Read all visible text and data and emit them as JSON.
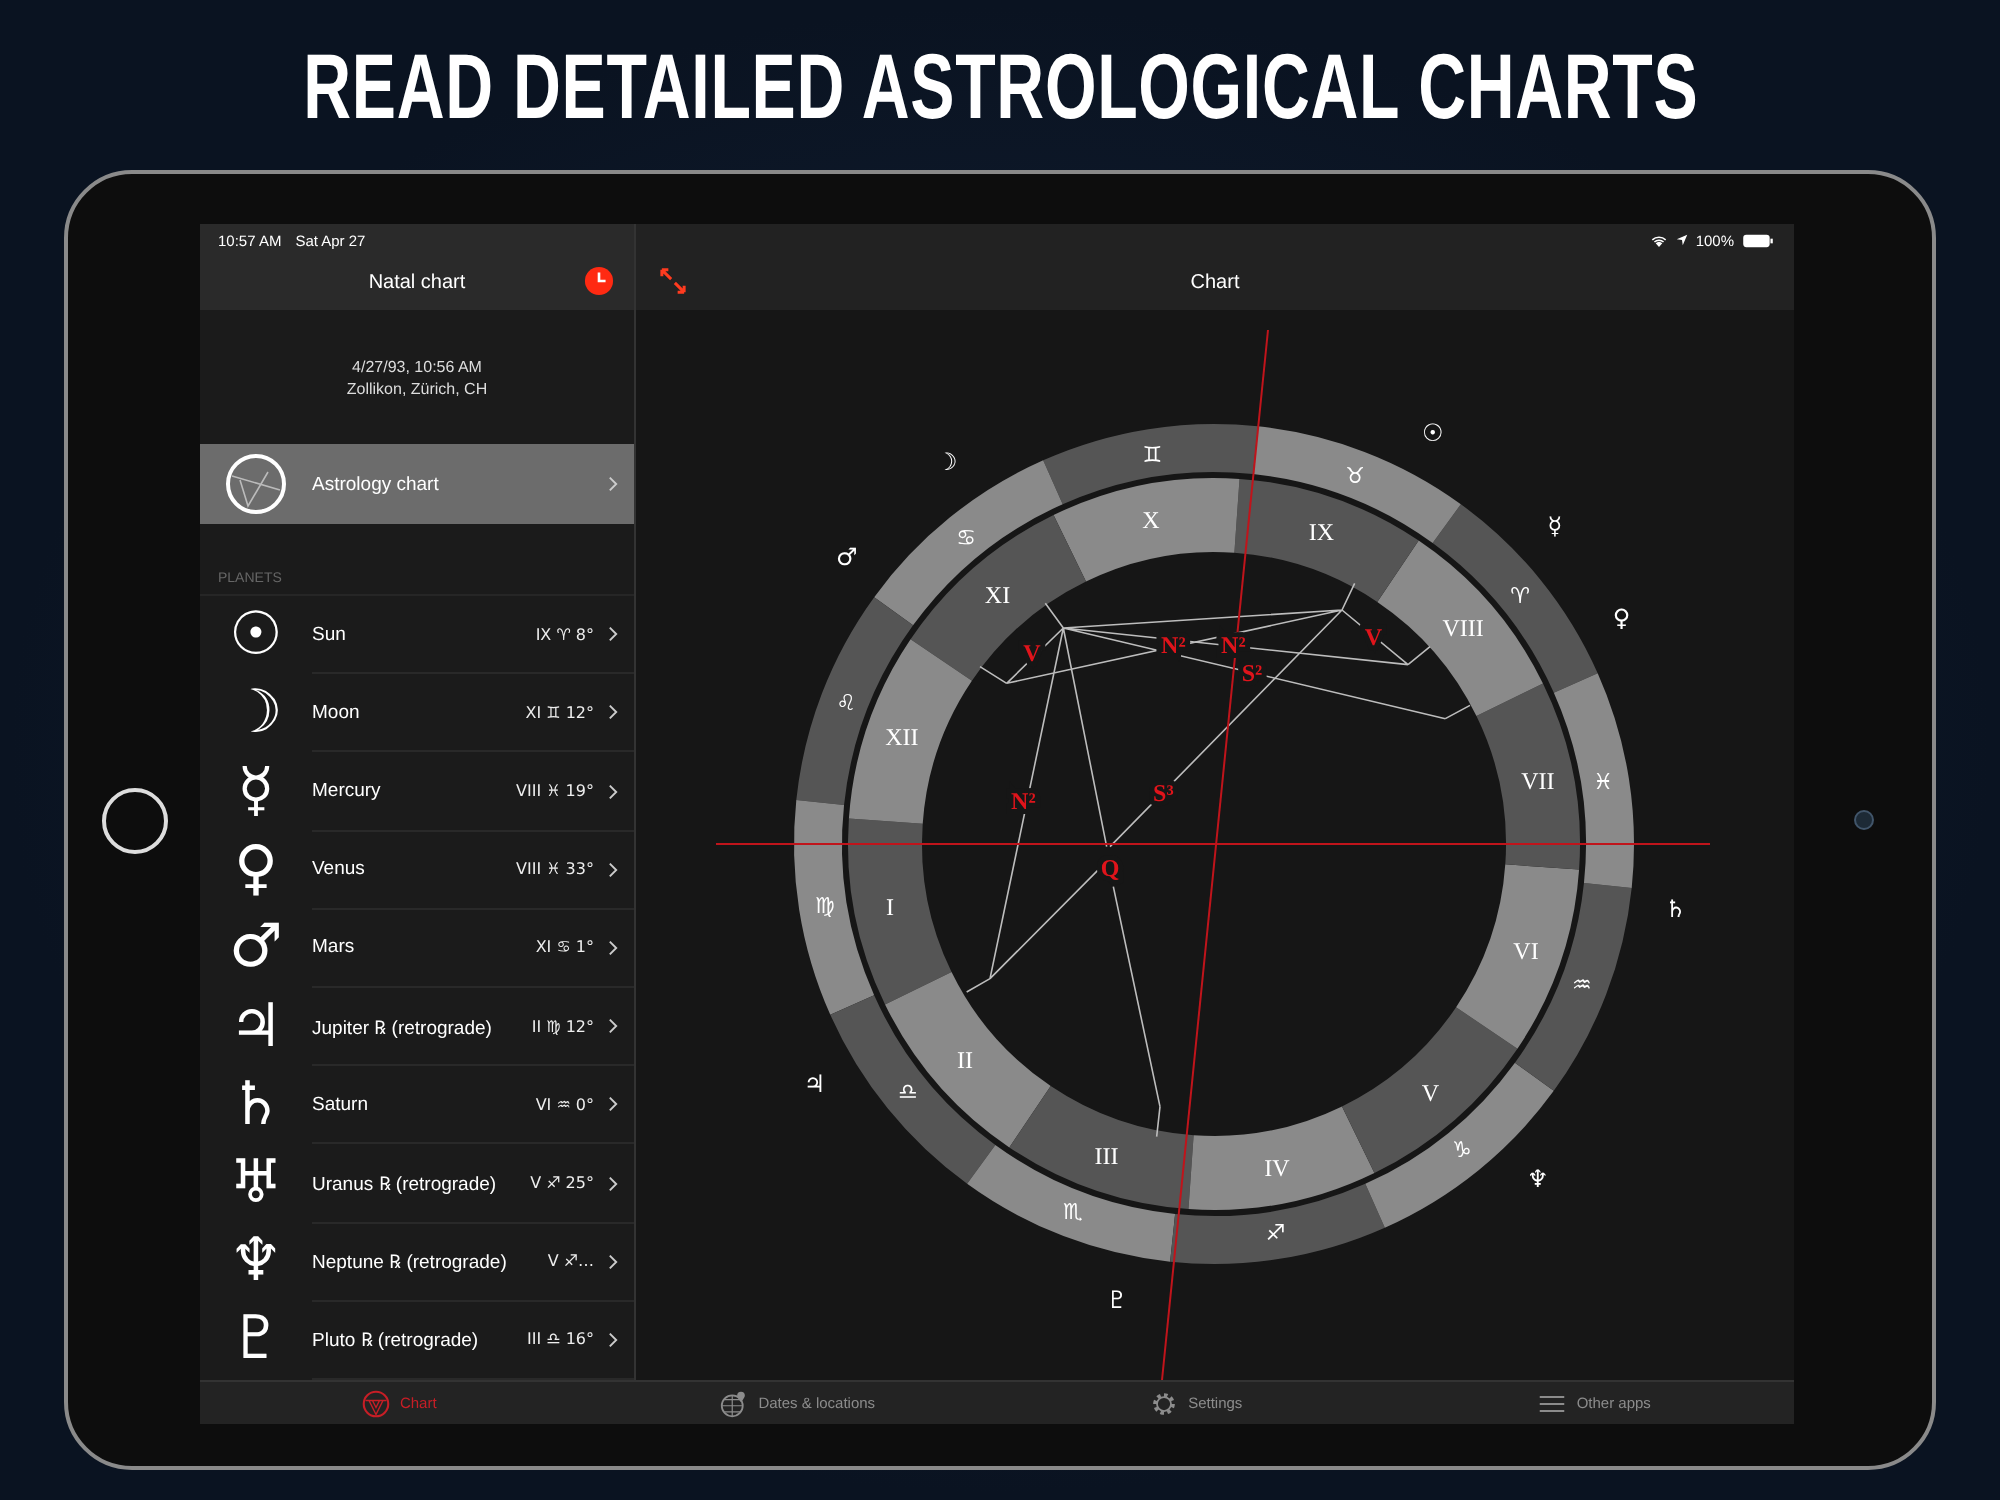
{
  "headline": "READ DETAILED ASTROLOGICAL CHARTS",
  "status_bar": {
    "time": "10:57 AM",
    "date": "Sat Apr 27",
    "battery": "100%"
  },
  "sidebar": {
    "title": "Natal chart",
    "birth_date": "4/27/93, 10:56 AM",
    "birth_place": "Zollikon, Zürich, CH",
    "menu_items": [
      {
        "label": "Astrology chart",
        "selected": true
      }
    ],
    "section_header": "PLANETS",
    "planets": [
      {
        "symbol": "☉",
        "name": "Sun",
        "position": "IX ♈ 8°"
      },
      {
        "symbol": "☽",
        "name": "Moon",
        "position": "XI ♊ 12°"
      },
      {
        "symbol": "☿",
        "name": "Mercury",
        "position": "VIII ♓ 19°"
      },
      {
        "symbol": "♀",
        "name": "Venus",
        "position": "VIII ♓ 33°"
      },
      {
        "symbol": "♂",
        "name": "Mars",
        "position": "XI ♋ 1°"
      },
      {
        "symbol": "♃",
        "name": "Jupiter ℞ (retrograde)",
        "position": "II ♍ 12°"
      },
      {
        "symbol": "♄",
        "name": "Saturn",
        "position": "VI ♒ 0°"
      },
      {
        "symbol": "♅",
        "name": "Uranus ℞ (retrograde)",
        "position": "V ♐ 25°"
      },
      {
        "symbol": "♆",
        "name": "Neptune ℞ (retrograde)",
        "position": "V ♐…"
      },
      {
        "symbol": "♇",
        "name": "Pluto ℞ (retrograde)",
        "position": "III ♎ 16°"
      }
    ]
  },
  "main": {
    "title": "Chart",
    "wheel": {
      "signs": [
        "♈",
        "♉",
        "♊",
        "♋",
        "♌",
        "♍",
        "♎",
        "♏",
        "♐",
        "♑",
        "♒",
        "♓"
      ],
      "houses": [
        "I",
        "II",
        "III",
        "IV",
        "V",
        "VI",
        "VII",
        "VIII",
        "IX",
        "X",
        "XI",
        "XII"
      ],
      "planets": [
        "☉",
        "☿",
        "♀",
        "♄",
        "♆",
        "♇",
        "♃",
        "♂",
        "☽"
      ],
      "aspects": [
        "V",
        "N²",
        "N²",
        "V",
        "S²",
        "N²",
        "S³",
        "Q"
      ]
    }
  },
  "tab_bar": [
    {
      "label": "Chart",
      "selected": true
    },
    {
      "label": "Dates & locations",
      "selected": false
    },
    {
      "label": "Settings",
      "selected": false
    },
    {
      "label": "Other apps",
      "selected": false
    }
  ]
}
